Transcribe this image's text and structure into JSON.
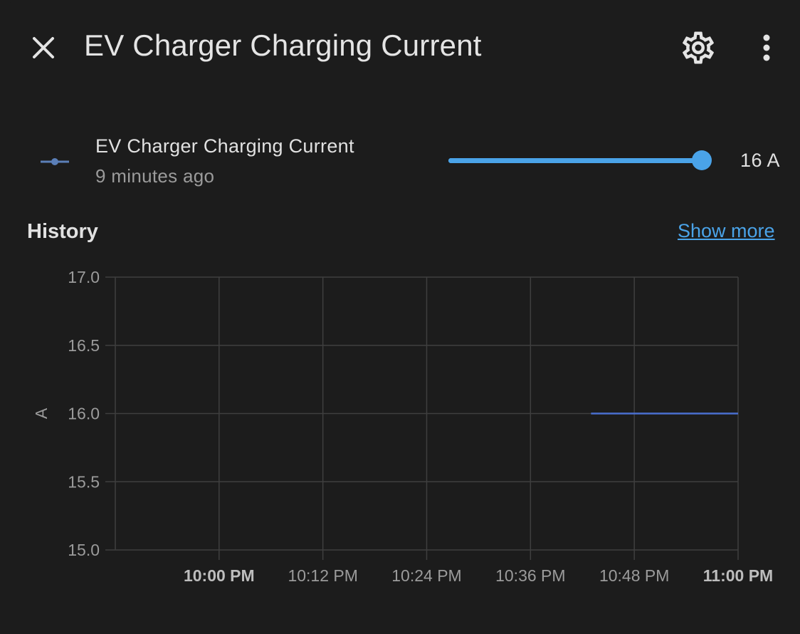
{
  "header": {
    "title": "EV Charger Charging Current",
    "close_icon": "close-icon",
    "settings_icon": "gear-icon",
    "menu_icon": "dots-vertical-icon"
  },
  "entity": {
    "name": "EV Charger Charging Current",
    "last_changed": "9 minutes ago",
    "icon": "slider-icon",
    "value_label": "16 A",
    "slider": {
      "min": 6,
      "max": 16,
      "value": 16
    },
    "accent_color": "#4aa3e8"
  },
  "history": {
    "title": "History",
    "show_more_label": "Show more"
  },
  "chart_data": {
    "type": "line",
    "ylabel": "A",
    "ylim": [
      15.0,
      17.0
    ],
    "y_ticks": [
      "17.0",
      "16.5",
      "16.0",
      "15.5",
      "15.0"
    ],
    "x_ticks": [
      {
        "label": "10:00 PM",
        "bold": true
      },
      {
        "label": "10:12 PM",
        "bold": false
      },
      {
        "label": "10:24 PM",
        "bold": false
      },
      {
        "label": "10:36 PM",
        "bold": false
      },
      {
        "label": "10:48 PM",
        "bold": false
      },
      {
        "label": "11:00 PM",
        "bold": true
      }
    ],
    "x_range": [
      "9:48 PM",
      "11:00 PM"
    ],
    "grid": true,
    "series": [
      {
        "color": "#4a6fd0",
        "points": [
          {
            "x": "10:43 PM",
            "y": 16.0
          },
          {
            "x": "11:00 PM",
            "y": 16.0
          }
        ]
      }
    ]
  }
}
